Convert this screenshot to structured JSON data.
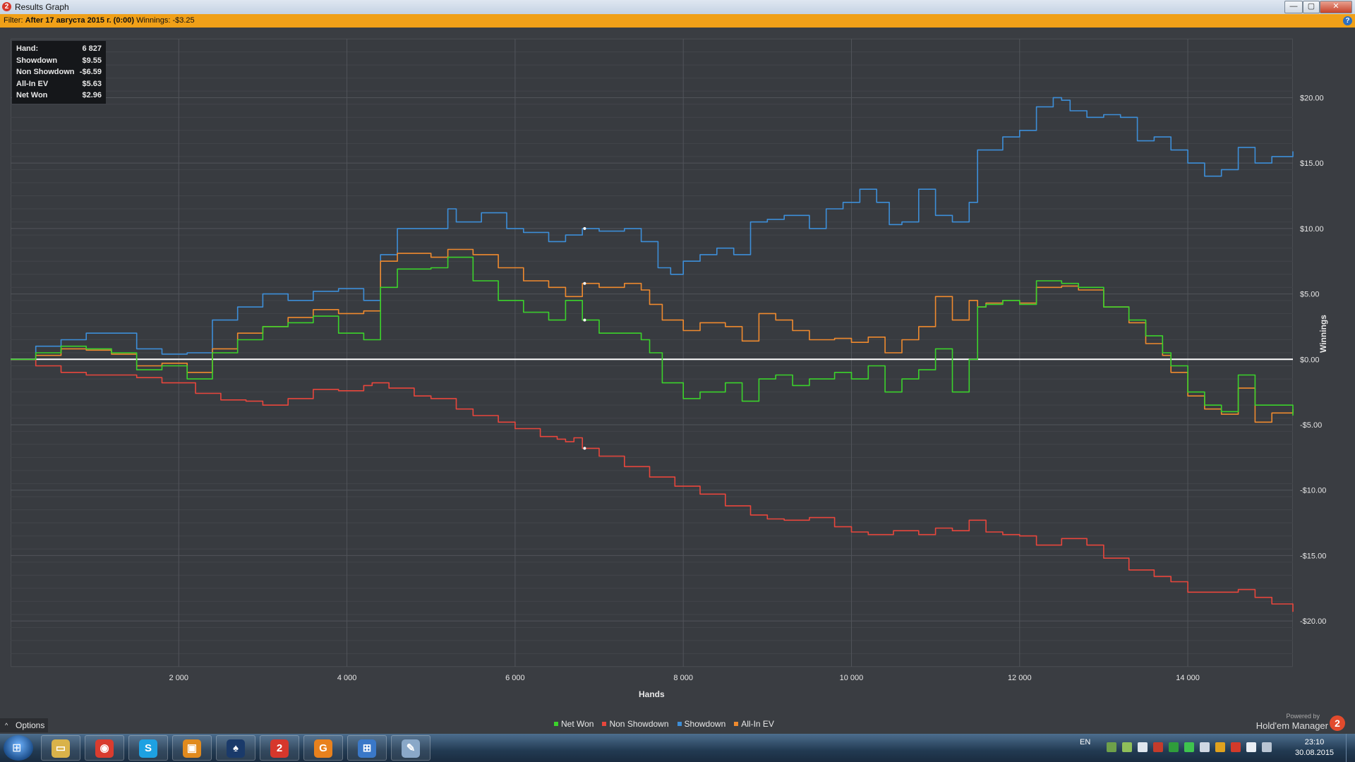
{
  "window": {
    "title": "Results Graph",
    "app_icon": "2",
    "buttons": {
      "minimize": "—",
      "maximize": "▢",
      "close": "✕"
    }
  },
  "filter_bar": {
    "label": "Filter:",
    "filter_value": "After 17 августа 2015 г. (0:00)",
    "winnings_label": "Winnings:",
    "winnings_value": "-$3.25",
    "help_icon": "?"
  },
  "stats_box": {
    "rows": [
      {
        "label": "Hand:",
        "value": "6 827"
      },
      {
        "label": "Showdown",
        "value": "$9.55"
      },
      {
        "label": "Non Showdown",
        "value": "-$6.59"
      },
      {
        "label": "All-In EV",
        "value": "$5.63"
      },
      {
        "label": "Net Won",
        "value": "$2.96"
      }
    ]
  },
  "chart_data": {
    "type": "line",
    "xlabel": "Hands",
    "ylabel": "Winnings",
    "xlim": [
      0,
      15250
    ],
    "ylim": [
      -23.5,
      24.5
    ],
    "x_ticks": [
      2000,
      4000,
      6000,
      8000,
      10000,
      12000,
      14000
    ],
    "x_tick_labels": [
      "2 000",
      "4 000",
      "6 000",
      "8 000",
      "10 000",
      "12 000",
      "14 000"
    ],
    "y_ticks": [
      20,
      15,
      10,
      5,
      0,
      -5,
      -10,
      -15,
      -20
    ],
    "y_tick_labels": [
      "$20.00",
      "$15.00",
      "$10.00",
      "$5.00",
      "$0.00",
      "-$5.00",
      "-$10.00",
      "-$15.00",
      "-$20.00"
    ],
    "grid": true,
    "legend_position": "bottom-center",
    "cursor_x": 6827,
    "series": [
      {
        "name": "Net Won",
        "color": "#3bd22b",
        "x": [
          0,
          300,
          600,
          900,
          1200,
          1500,
          1800,
          2100,
          2400,
          2700,
          3000,
          3300,
          3600,
          3900,
          4200,
          4400,
          4600,
          5000,
          5200,
          5500,
          5800,
          6100,
          6400,
          6600,
          6800,
          7000,
          7300,
          7500,
          7600,
          7750,
          8000,
          8200,
          8500,
          8700,
          8900,
          9100,
          9300,
          9500,
          9800,
          10000,
          10200,
          10400,
          10600,
          10800,
          11000,
          11200,
          11400,
          11500,
          11600,
          11800,
          12000,
          12200,
          12500,
          12700,
          13000,
          13300,
          13500,
          13700,
          13800,
          14000,
          14200,
          14400,
          14600,
          14800,
          15000,
          15250
        ],
        "y": [
          0,
          0.5,
          1.0,
          0.8,
          0.5,
          -0.8,
          -0.5,
          -1.5,
          0.5,
          1.5,
          2.5,
          2.8,
          3.3,
          2.0,
          1.5,
          5.5,
          6.9,
          7.0,
          7.8,
          6.0,
          4.5,
          3.6,
          3.0,
          4.5,
          3.0,
          2.0,
          2.0,
          1.5,
          0.5,
          -1.8,
          -3.0,
          -2.5,
          -1.8,
          -3.2,
          -1.5,
          -1.2,
          -2.0,
          -1.5,
          -1.0,
          -1.5,
          -0.5,
          -2.5,
          -1.5,
          -0.8,
          0.8,
          -2.5,
          0.0,
          4.0,
          4.2,
          4.5,
          4.2,
          6.0,
          5.8,
          5.5,
          4.0,
          3.0,
          1.8,
          0.5,
          -0.5,
          -2.5,
          -3.5,
          -4.0,
          -1.2,
          -3.5,
          -3.5,
          -4.3
        ]
      },
      {
        "name": "Non Showdown",
        "color": "#e8463c",
        "x": [
          0,
          300,
          600,
          900,
          1200,
          1500,
          1800,
          2000,
          2200,
          2500,
          2800,
          3000,
          3300,
          3600,
          3900,
          4200,
          4300,
          4500,
          4800,
          5000,
          5300,
          5500,
          5800,
          6000,
          6300,
          6500,
          6600,
          6700,
          6800,
          7000,
          7300,
          7600,
          7900,
          8200,
          8500,
          8800,
          9000,
          9200,
          9500,
          9800,
          10000,
          10200,
          10500,
          10800,
          11000,
          11200,
          11400,
          11600,
          11800,
          12000,
          12200,
          12500,
          12800,
          13000,
          13300,
          13600,
          13800,
          14000,
          14300,
          14600,
          14800,
          15000,
          15250
        ],
        "y": [
          0,
          -0.5,
          -1.0,
          -1.2,
          -1.2,
          -1.4,
          -1.8,
          -1.8,
          -2.6,
          -3.1,
          -3.2,
          -3.5,
          -3.0,
          -2.3,
          -2.4,
          -2.0,
          -1.8,
          -2.2,
          -2.8,
          -3.0,
          -3.8,
          -4.3,
          -4.8,
          -5.3,
          -5.9,
          -6.1,
          -6.3,
          -6.0,
          -6.8,
          -7.4,
          -8.2,
          -9.0,
          -9.7,
          -10.3,
          -11.2,
          -11.9,
          -12.2,
          -12.3,
          -12.1,
          -12.8,
          -13.2,
          -13.4,
          -13.1,
          -13.4,
          -12.9,
          -13.1,
          -12.3,
          -13.2,
          -13.4,
          -13.5,
          -14.2,
          -13.7,
          -14.2,
          -15.2,
          -16.1,
          -16.6,
          -17.0,
          -17.8,
          -17.8,
          -17.6,
          -18.2,
          -18.7,
          -19.3
        ]
      },
      {
        "name": "Showdown",
        "color": "#3d8ed8",
        "x": [
          0,
          300,
          600,
          900,
          1200,
          1500,
          1800,
          2100,
          2400,
          2700,
          3000,
          3300,
          3600,
          3900,
          4200,
          4400,
          4600,
          5000,
          5200,
          5300,
          5600,
          5900,
          6100,
          6400,
          6600,
          6800,
          7000,
          7300,
          7500,
          7700,
          7850,
          8000,
          8200,
          8400,
          8600,
          8800,
          9000,
          9200,
          9500,
          9700,
          9900,
          10100,
          10300,
          10450,
          10600,
          10800,
          11000,
          11200,
          11400,
          11500,
          11800,
          12000,
          12200,
          12400,
          12500,
          12600,
          12800,
          13000,
          13200,
          13400,
          13600,
          13800,
          14000,
          14200,
          14400,
          14600,
          14800,
          15000,
          15250
        ],
        "y": [
          0,
          1.0,
          1.5,
          2.0,
          2.0,
          0.8,
          0.4,
          0.5,
          3.0,
          4.0,
          5.0,
          4.5,
          5.2,
          5.4,
          4.5,
          8.0,
          10.0,
          10.0,
          11.5,
          10.5,
          11.2,
          10.0,
          9.7,
          9.0,
          9.5,
          10.0,
          9.8,
          10.0,
          9.0,
          7.0,
          6.5,
          7.5,
          8.0,
          8.5,
          8.0,
          10.5,
          10.7,
          11.0,
          10.0,
          11.5,
          12.0,
          13.0,
          12.0,
          10.3,
          10.5,
          13.0,
          11.0,
          10.5,
          12.0,
          16.0,
          17.0,
          17.5,
          19.3,
          20.0,
          19.8,
          19.0,
          18.5,
          18.7,
          18.5,
          16.7,
          17.0,
          16.0,
          15.0,
          14.0,
          14.5,
          16.2,
          15.0,
          15.5,
          15.9
        ]
      },
      {
        "name": "All-In EV",
        "color": "#ef8a2e",
        "x": [
          0,
          300,
          600,
          900,
          1200,
          1500,
          1800,
          2100,
          2400,
          2700,
          3000,
          3300,
          3600,
          3900,
          4200,
          4400,
          4600,
          5000,
          5200,
          5500,
          5800,
          6100,
          6400,
          6600,
          6800,
          7000,
          7300,
          7500,
          7600,
          7750,
          8000,
          8200,
          8500,
          8700,
          8900,
          9100,
          9300,
          9500,
          9800,
          10000,
          10200,
          10400,
          10600,
          10800,
          11000,
          11200,
          11400,
          11500,
          11600,
          11800,
          12000,
          12200,
          12500,
          12700,
          13000,
          13300,
          13500,
          13700,
          13800,
          14000,
          14200,
          14400,
          14600,
          14800,
          15000,
          15250
        ],
        "y": [
          0,
          0.3,
          0.8,
          0.7,
          0.4,
          -0.5,
          -0.3,
          -1.0,
          0.8,
          2.0,
          2.5,
          3.2,
          3.8,
          3.5,
          3.7,
          7.5,
          8.1,
          7.8,
          8.4,
          8.0,
          7.0,
          6.0,
          5.5,
          4.8,
          5.8,
          5.5,
          5.8,
          5.3,
          4.2,
          3.0,
          2.2,
          2.8,
          2.5,
          1.4,
          3.5,
          3.0,
          2.2,
          1.5,
          1.6,
          1.3,
          1.7,
          0.5,
          1.5,
          2.5,
          4.8,
          3.0,
          4.5,
          4.0,
          4.3,
          4.5,
          4.3,
          5.5,
          5.6,
          5.3,
          4.0,
          2.8,
          1.2,
          0.3,
          -1.0,
          -2.8,
          -3.8,
          -4.2,
          -2.2,
          -4.8,
          -4.1,
          -3.8
        ]
      }
    ]
  },
  "options": {
    "label": "Options",
    "caret": "^"
  },
  "branding": {
    "powered_by": "Powered by",
    "name": "Hold'em Manager",
    "logo": "2"
  },
  "taskbar": {
    "start_icon": "windows-start-icon",
    "buttons": [
      {
        "name": "explorer",
        "glyph": "▭",
        "color": "#d9b24a"
      },
      {
        "name": "chrome",
        "glyph": "◉",
        "color": "#d93c2f"
      },
      {
        "name": "skype",
        "glyph": "S",
        "color": "#1da1e2"
      },
      {
        "name": "virtualbox",
        "glyph": "▣",
        "color": "#e08a1e"
      },
      {
        "name": "pokerstars",
        "glyph": "♠",
        "color": "#1a3a6a"
      },
      {
        "name": "holdem-manager",
        "glyph": "2",
        "color": "#d6372c"
      },
      {
        "name": "pdf-tool",
        "glyph": "G",
        "color": "#e8811d"
      },
      {
        "name": "remote-desktop",
        "glyph": "⊞",
        "color": "#3a78c8"
      },
      {
        "name": "paint",
        "glyph": "✎",
        "color": "#8aa8c8"
      }
    ],
    "lang": "EN",
    "time": "23:10",
    "date": "30.08.2015"
  }
}
